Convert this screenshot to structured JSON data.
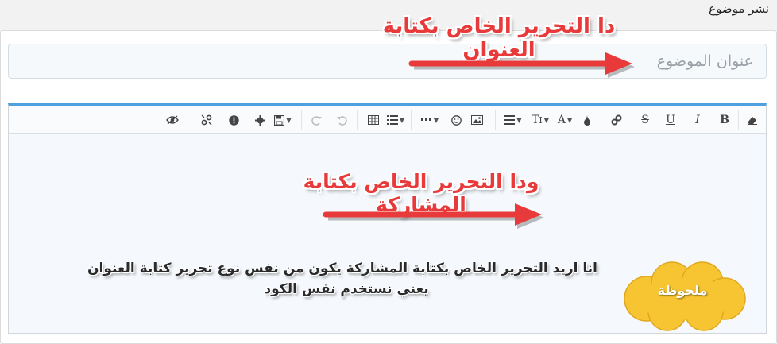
{
  "page": {
    "heading": "نشر موضوع"
  },
  "title_field": {
    "placeholder": "عنوان الموضوع"
  },
  "toolbar": {
    "buttons": [
      {
        "name": "eraser-icon",
        "glyph": "⌫"
      },
      {
        "name": "bold-icon",
        "glyph": "B"
      },
      {
        "name": "italic-icon",
        "glyph": "I"
      },
      {
        "name": "underline-icon",
        "glyph": "U"
      },
      {
        "name": "strikethrough-icon",
        "glyph": "S"
      },
      {
        "name": "link-icon",
        "glyph": "🔗"
      },
      {
        "name": "text-color-icon",
        "glyph": "💧"
      },
      {
        "name": "font-family-icon",
        "glyph": "A"
      },
      {
        "name": "font-size-icon",
        "glyph": "T‡"
      },
      {
        "name": "align-icon",
        "glyph": "≡"
      },
      {
        "name": "image-icon",
        "glyph": "🖼"
      },
      {
        "name": "smiley-icon",
        "glyph": "☺"
      },
      {
        "name": "more-icon",
        "glyph": "···"
      },
      {
        "name": "list-icon",
        "glyph": "☰"
      },
      {
        "name": "table-icon",
        "glyph": "▦"
      },
      {
        "name": "undo-icon",
        "glyph": "↶"
      },
      {
        "name": "redo-icon",
        "glyph": "↷"
      },
      {
        "name": "save-icon",
        "glyph": "💾"
      },
      {
        "name": "gear-icon",
        "glyph": "⚙"
      },
      {
        "name": "alert-icon",
        "glyph": "!"
      },
      {
        "name": "unlink-icon",
        "glyph": "✂"
      },
      {
        "name": "preview-icon",
        "glyph": "👁"
      }
    ]
  },
  "annotations": {
    "title_note": "دا التحرير الخاص بكتابة العنوان",
    "body_note": "ودا التحرير الخاص بكتابة المشاركة",
    "request_line1": "انا اريد التحرير الخاص بكتابة المشاركة يكون من نفس نوع تحرير كتابة العنوان",
    "request_line2": "يعني نستخدم نفس الكود",
    "cloud_label": "ملحوظة"
  },
  "colors": {
    "accent": "#4ea1de",
    "annotation_red": "#e83a3a",
    "cloud_yellow": "#f7c531"
  }
}
